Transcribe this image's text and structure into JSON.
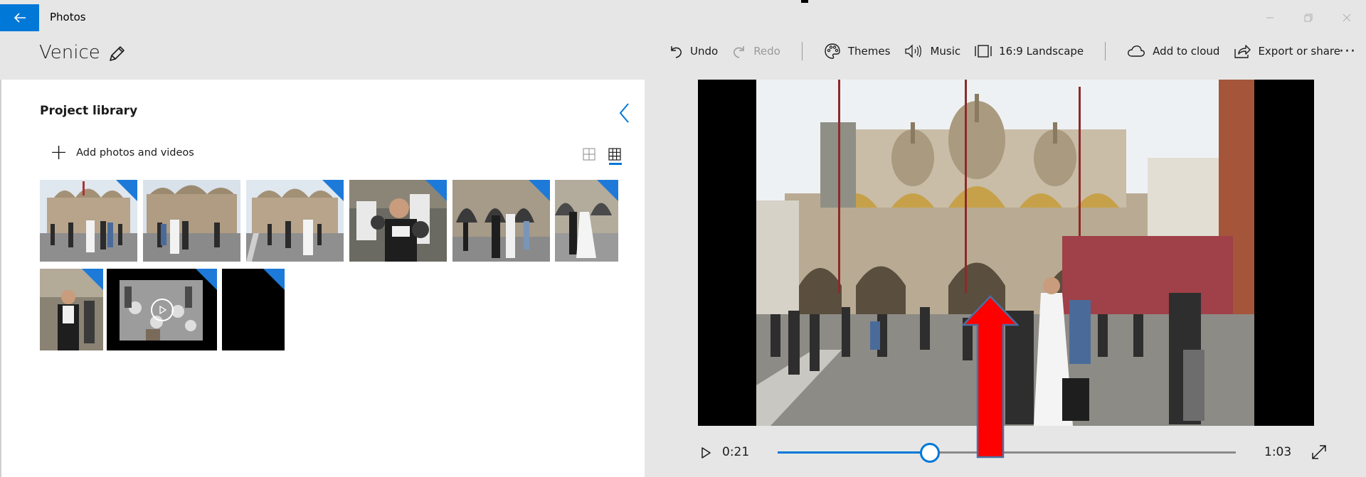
{
  "titlebar": {
    "app_title": "Photos",
    "back_icon": "arrow-left-icon",
    "window_controls": [
      "minimize-icon",
      "maximize-icon",
      "close-icon"
    ]
  },
  "header": {
    "project_title": "Venice",
    "edit_icon": "pencil-icon",
    "toolbar": {
      "undo": "Undo",
      "redo": "Redo",
      "themes": "Themes",
      "music": "Music",
      "aspect": "16:9 Landscape",
      "cloud": "Add to cloud",
      "export": "Export or share",
      "more": "···"
    }
  },
  "library": {
    "title": "Project library",
    "add_label": "Add photos and videos",
    "thumbnails": [
      {
        "kind": "photo",
        "in_storyboard": true
      },
      {
        "kind": "photo",
        "in_storyboard": false
      },
      {
        "kind": "photo",
        "in_storyboard": true
      },
      {
        "kind": "photo",
        "in_storyboard": true
      },
      {
        "kind": "photo",
        "in_storyboard": true
      },
      {
        "kind": "photo",
        "in_storyboard": true
      },
      {
        "kind": "photo",
        "in_storyboard": true
      },
      {
        "kind": "video",
        "in_storyboard": true
      },
      {
        "kind": "blank",
        "in_storyboard": true
      }
    ]
  },
  "player": {
    "current_time": "0:21",
    "total_time": "1:03",
    "progress": 0.333
  },
  "colors": {
    "accent": "#0078d7",
    "chrome": "#e6e6e6",
    "annotation_arrow": "#ff0000"
  }
}
